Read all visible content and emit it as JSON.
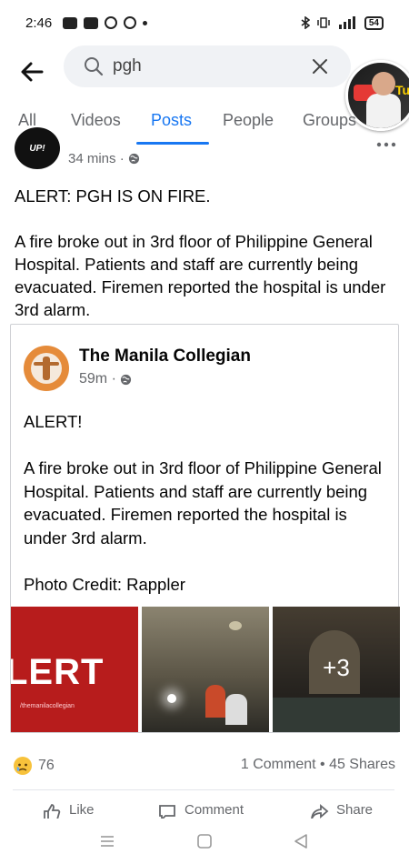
{
  "status_bar": {
    "time": "2:46",
    "battery": "54"
  },
  "search": {
    "value": "pgh"
  },
  "tabs": [
    {
      "label": "All"
    },
    {
      "label": "Videos"
    },
    {
      "label": "Posts"
    },
    {
      "label": "People"
    },
    {
      "label": "Groups"
    }
  ],
  "post": {
    "author_avatar_text": "UP!",
    "time": "34 mins ·",
    "paragraphs": [
      "ALERT: PGH IS ON FIRE.",
      "A fire broke out in 3rd floor of Philippine General Hospital. Patients and staff are currently being evacuated. Firemen reported the hospital is under 3rd alarm."
    ]
  },
  "shared": {
    "page_name": "The Manila Collegian",
    "time": "59m ·",
    "paragraphs": [
      "ALERT!",
      "A fire broke out in 3rd floor of Philippine General Hospital. Patients and staff are currently being evacuated. Firemen reported the hospital is under 3rd alarm.",
      "Photo Credit: Rappler"
    ],
    "photo1_text": "LERT",
    "photo1_handle": "/themanilacollegian",
    "more_photos": "+3"
  },
  "engagement": {
    "reaction_count": "76",
    "comments_shares": "1 Comment • 45 Shares"
  },
  "actions": {
    "like": "Like",
    "comment": "Comment",
    "share": "Share"
  }
}
